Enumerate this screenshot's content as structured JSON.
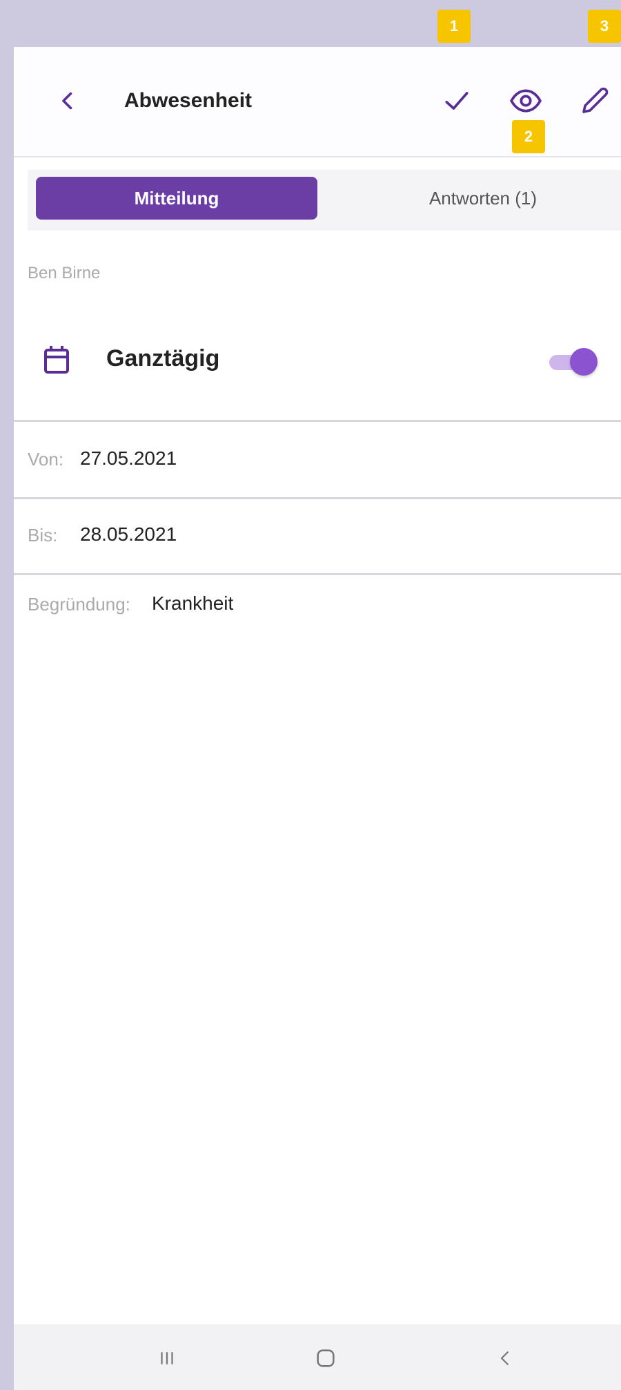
{
  "header": {
    "title": "Abwesenheit",
    "back_icon": "chevron-left-icon",
    "actions": [
      "check-icon",
      "eye-icon",
      "pencil-icon"
    ]
  },
  "markers": [
    "1",
    "2",
    "3"
  ],
  "tabs": [
    {
      "label": "Mitteilung",
      "active": true
    },
    {
      "label": "Antworten (1)",
      "active": false
    }
  ],
  "message": {
    "author": "Ben Birne",
    "all_day_label": "Ganztägig",
    "all_day_enabled": true,
    "from_label": "Von:",
    "from_value": "27.05.2021",
    "to_label": "Bis:",
    "to_value": "28.05.2021",
    "reason_label": "Begründung:",
    "reason_value": "Krankheit"
  },
  "colors": {
    "accent": "#6b3ea6",
    "toggle": "#8b53cf",
    "marker": "#f6c500",
    "background": "#cdcae0"
  },
  "navbar": [
    "recent-apps-icon",
    "home-icon",
    "back-icon"
  ]
}
